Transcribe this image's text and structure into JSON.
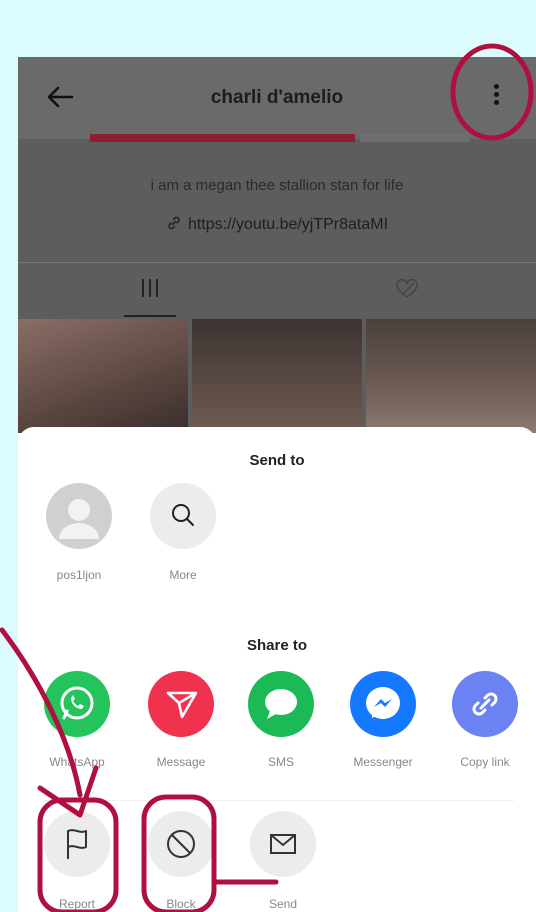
{
  "header": {
    "title": "charli d'amelio",
    "bio": "i am a megan thee stallion stan for life",
    "link": "https://youtu.be/yjTPr8ataMI"
  },
  "send_to": {
    "title": "Send to",
    "items": [
      {
        "label": "pos1ljon",
        "icon": "avatar-icon"
      },
      {
        "label": "More",
        "icon": "search-icon"
      }
    ]
  },
  "share_to": {
    "title": "Share to",
    "items": [
      {
        "label": "WhatsApp",
        "icon": "whatsapp-icon",
        "color": "#25c35c"
      },
      {
        "label": "Message",
        "icon": "send-icon",
        "color": "#f0324f"
      },
      {
        "label": "SMS",
        "icon": "chat-bubble-icon",
        "color": "#1cba57"
      },
      {
        "label": "Messenger",
        "icon": "messenger-icon",
        "color": "#1479ff"
      },
      {
        "label": "Copy link",
        "icon": "link-icon",
        "color": "#6b82f2"
      }
    ]
  },
  "actions": {
    "items": [
      {
        "label": "Report",
        "icon": "flag-icon"
      },
      {
        "label": "Block",
        "icon": "block-icon"
      },
      {
        "label": "Send",
        "icon": "envelope-icon"
      }
    ]
  },
  "colors": {
    "annotation": "#b0103f",
    "background": "#dbfbfd"
  }
}
